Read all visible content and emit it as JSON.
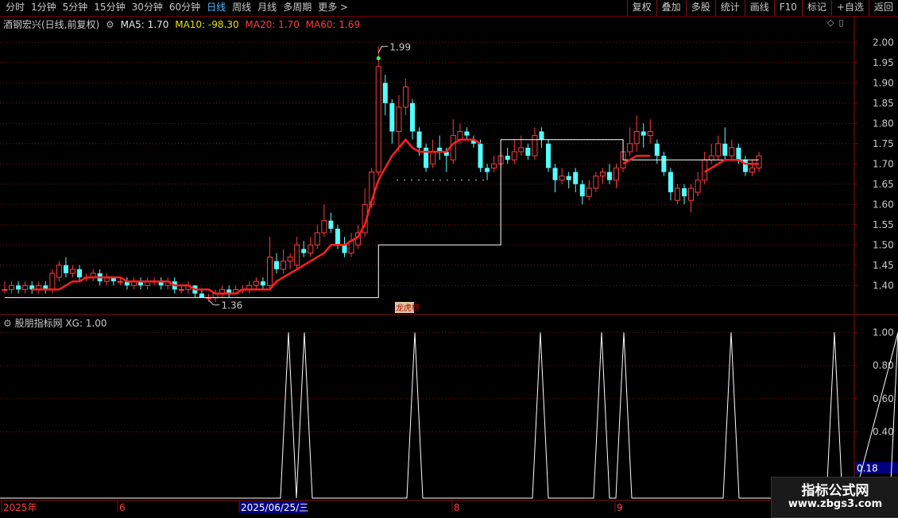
{
  "toolbar": {
    "periods": [
      "分时",
      "1分钟",
      "5分钟",
      "15分钟",
      "30分钟",
      "60分钟",
      "日线",
      "周线",
      "月线",
      "多周期",
      "更多 >"
    ],
    "active_period": "日线",
    "right_buttons": [
      "复权",
      "叠加",
      "多股",
      "统计",
      "画线",
      "F10",
      "标记",
      "+自选",
      "返回"
    ]
  },
  "main_panel": {
    "stock_label": "酒钢宏兴(日线,前复权)",
    "ma5": "MA5: 1.70",
    "ma10": "MA10: -98.30",
    "ma20": "MA20: 1.70",
    "ma60": "MA60: 1.69",
    "high_annotation": "1.99",
    "low_annotation": "1.36",
    "tag_label": "龙虎榜"
  },
  "sub_panel": {
    "title": "股朋指标网 XG: 1.00",
    "current_value": "0.18"
  },
  "x_axis": {
    "labels": [
      "2025年",
      "6",
      "2025/06/25/三",
      "8",
      "9"
    ]
  },
  "colors": {
    "up": "#ff3c3c",
    "down": "#54ffff",
    "grid": "#8a1010",
    "ma_red": "#ff2020",
    "ma_white": "#ffffff",
    "indicator": "#ffffff"
  },
  "watermark": {
    "title": "指标公式网",
    "url": "www.zbgs3.com"
  },
  "chart_data": [
    {
      "type": "candlestick",
      "ylim": [
        1.33,
        2.03
      ],
      "yticks": [
        1.4,
        1.45,
        1.5,
        1.55,
        1.6,
        1.65,
        1.7,
        1.75,
        1.8,
        1.85,
        1.9,
        1.95,
        2.0
      ],
      "candles": [
        [
          1.39,
          1.39,
          1.41,
          1.38
        ],
        [
          1.39,
          1.4,
          1.41,
          1.38
        ],
        [
          1.4,
          1.39,
          1.41,
          1.38
        ],
        [
          1.39,
          1.4,
          1.41,
          1.38
        ],
        [
          1.4,
          1.39,
          1.41,
          1.38
        ],
        [
          1.39,
          1.4,
          1.41,
          1.38
        ],
        [
          1.4,
          1.39,
          1.41,
          1.38
        ],
        [
          1.39,
          1.43,
          1.44,
          1.38
        ],
        [
          1.42,
          1.45,
          1.46,
          1.41
        ],
        [
          1.45,
          1.43,
          1.47,
          1.42
        ],
        [
          1.43,
          1.44,
          1.45,
          1.42
        ],
        [
          1.44,
          1.42,
          1.45,
          1.41
        ],
        [
          1.42,
          1.42,
          1.43,
          1.41
        ],
        [
          1.42,
          1.43,
          1.44,
          1.41
        ],
        [
          1.43,
          1.41,
          1.44,
          1.4
        ],
        [
          1.41,
          1.42,
          1.43,
          1.4
        ],
        [
          1.42,
          1.41,
          1.42,
          1.4
        ],
        [
          1.41,
          1.41,
          1.42,
          1.4
        ],
        [
          1.41,
          1.4,
          1.42,
          1.39
        ],
        [
          1.4,
          1.41,
          1.42,
          1.39
        ],
        [
          1.41,
          1.4,
          1.42,
          1.39
        ],
        [
          1.4,
          1.41,
          1.42,
          1.39
        ],
        [
          1.41,
          1.41,
          1.42,
          1.4
        ],
        [
          1.41,
          1.4,
          1.42,
          1.39
        ],
        [
          1.4,
          1.41,
          1.42,
          1.39
        ],
        [
          1.41,
          1.39,
          1.42,
          1.38
        ],
        [
          1.39,
          1.39,
          1.4,
          1.38
        ],
        [
          1.39,
          1.4,
          1.41,
          1.38
        ],
        [
          1.4,
          1.38,
          1.4,
          1.37
        ],
        [
          1.38,
          1.37,
          1.39,
          1.37
        ],
        [
          1.37,
          1.37,
          1.38,
          1.36
        ],
        [
          1.37,
          1.38,
          1.39,
          1.36
        ],
        [
          1.38,
          1.39,
          1.4,
          1.37
        ],
        [
          1.39,
          1.38,
          1.4,
          1.37
        ],
        [
          1.38,
          1.39,
          1.4,
          1.38
        ],
        [
          1.39,
          1.39,
          1.4,
          1.38
        ],
        [
          1.39,
          1.4,
          1.41,
          1.38
        ],
        [
          1.4,
          1.41,
          1.42,
          1.39
        ],
        [
          1.41,
          1.4,
          1.42,
          1.39
        ],
        [
          1.4,
          1.47,
          1.52,
          1.39
        ],
        [
          1.46,
          1.44,
          1.48,
          1.43
        ],
        [
          1.44,
          1.46,
          1.49,
          1.43
        ],
        [
          1.46,
          1.47,
          1.48,
          1.44
        ],
        [
          1.45,
          1.5,
          1.52,
          1.44
        ],
        [
          1.49,
          1.48,
          1.51,
          1.47
        ],
        [
          1.48,
          1.5,
          1.52,
          1.47
        ],
        [
          1.5,
          1.53,
          1.55,
          1.49
        ],
        [
          1.53,
          1.56,
          1.6,
          1.52
        ],
        [
          1.56,
          1.54,
          1.58,
          1.53
        ],
        [
          1.54,
          1.5,
          1.55,
          1.49
        ],
        [
          1.5,
          1.48,
          1.52,
          1.47
        ],
        [
          1.48,
          1.51,
          1.53,
          1.47
        ],
        [
          1.5,
          1.53,
          1.55,
          1.49
        ],
        [
          1.53,
          1.6,
          1.64,
          1.52
        ],
        [
          1.6,
          1.68,
          1.69,
          1.59
        ],
        [
          1.68,
          1.94,
          1.99,
          1.67
        ],
        [
          1.9,
          1.85,
          1.92,
          1.82
        ],
        [
          1.85,
          1.78,
          1.86,
          1.75
        ],
        [
          1.78,
          1.84,
          1.87,
          1.73
        ],
        [
          1.84,
          1.89,
          1.91,
          1.82
        ],
        [
          1.85,
          1.78,
          1.86,
          1.76
        ],
        [
          1.78,
          1.74,
          1.79,
          1.72
        ],
        [
          1.74,
          1.69,
          1.75,
          1.68
        ],
        [
          1.7,
          1.73,
          1.76,
          1.69
        ],
        [
          1.74,
          1.73,
          1.77,
          1.71
        ],
        [
          1.73,
          1.72,
          1.74,
          1.68
        ],
        [
          1.71,
          1.77,
          1.81,
          1.7
        ],
        [
          1.76,
          1.78,
          1.8,
          1.75
        ],
        [
          1.78,
          1.77,
          1.79,
          1.76
        ],
        [
          1.76,
          1.75,
          1.77,
          1.74
        ],
        [
          1.75,
          1.69,
          1.76,
          1.68
        ],
        [
          1.69,
          1.68,
          1.7,
          1.66
        ],
        [
          1.69,
          1.7,
          1.72,
          1.68
        ],
        [
          1.7,
          1.72,
          1.73,
          1.69
        ],
        [
          1.72,
          1.71,
          1.74,
          1.7
        ],
        [
          1.71,
          1.73,
          1.76,
          1.7
        ],
        [
          1.73,
          1.74,
          1.77,
          1.72
        ],
        [
          1.74,
          1.72,
          1.75,
          1.71
        ],
        [
          1.72,
          1.77,
          1.79,
          1.71
        ],
        [
          1.78,
          1.76,
          1.79,
          1.74
        ],
        [
          1.75,
          1.69,
          1.76,
          1.68
        ],
        [
          1.69,
          1.66,
          1.7,
          1.63
        ],
        [
          1.66,
          1.67,
          1.69,
          1.65
        ],
        [
          1.67,
          1.66,
          1.68,
          1.64
        ],
        [
          1.68,
          1.65,
          1.69,
          1.63
        ],
        [
          1.65,
          1.62,
          1.66,
          1.6
        ],
        [
          1.62,
          1.64,
          1.66,
          1.61
        ],
        [
          1.64,
          1.67,
          1.68,
          1.63
        ],
        [
          1.67,
          1.68,
          1.69,
          1.65
        ],
        [
          1.68,
          1.66,
          1.7,
          1.65
        ],
        [
          1.66,
          1.69,
          1.7,
          1.64
        ],
        [
          1.69,
          1.73,
          1.76,
          1.68
        ],
        [
          1.73,
          1.75,
          1.79,
          1.72
        ],
        [
          1.75,
          1.78,
          1.82,
          1.73
        ],
        [
          1.78,
          1.77,
          1.8,
          1.74
        ],
        [
          1.77,
          1.78,
          1.81,
          1.75
        ],
        [
          1.75,
          1.72,
          1.76,
          1.7
        ],
        [
          1.72,
          1.68,
          1.73,
          1.67
        ],
        [
          1.68,
          1.63,
          1.69,
          1.61
        ],
        [
          1.61,
          1.64,
          1.65,
          1.6
        ],
        [
          1.64,
          1.62,
          1.65,
          1.6
        ],
        [
          1.61,
          1.64,
          1.65,
          1.58
        ],
        [
          1.63,
          1.66,
          1.68,
          1.62
        ],
        [
          1.66,
          1.71,
          1.73,
          1.65
        ],
        [
          1.71,
          1.72,
          1.75,
          1.7
        ],
        [
          1.72,
          1.75,
          1.77,
          1.71
        ],
        [
          1.75,
          1.72,
          1.79,
          1.71
        ],
        [
          1.72,
          1.74,
          1.76,
          1.71
        ],
        [
          1.74,
          1.71,
          1.75,
          1.7
        ],
        [
          1.71,
          1.68,
          1.72,
          1.67
        ],
        [
          1.68,
          1.69,
          1.71,
          1.67
        ],
        [
          1.69,
          1.72,
          1.73,
          1.68
        ]
      ],
      "ma_red": [
        null,
        null,
        null,
        null,
        1.39,
        1.39,
        1.39,
        1.39,
        1.39,
        1.4,
        1.41,
        1.41,
        1.42,
        1.42,
        1.42,
        1.42,
        1.42,
        1.42,
        1.41,
        1.41,
        1.41,
        1.41,
        1.41,
        1.41,
        1.41,
        1.4,
        1.4,
        1.4,
        1.39,
        1.39,
        1.39,
        1.38,
        1.38,
        1.38,
        1.38,
        1.39,
        1.39,
        1.39,
        1.39,
        1.39,
        1.41,
        1.42,
        1.43,
        1.44,
        1.45,
        1.46,
        1.47,
        1.48,
        1.5,
        1.5,
        1.5,
        1.51,
        1.52,
        1.55,
        1.61,
        1.66,
        1.69,
        1.72,
        1.74,
        1.76,
        1.74,
        1.73,
        1.73,
        1.73,
        1.73,
        1.73,
        1.75,
        1.76,
        1.76,
        1.76,
        1.75,
        null,
        null,
        null,
        null,
        null,
        null,
        null,
        null,
        null,
        null,
        null,
        null,
        null,
        null,
        null,
        null,
        null,
        null,
        null,
        null,
        1.7,
        1.71,
        1.72,
        1.72,
        1.72,
        null,
        null,
        null,
        null,
        null,
        null,
        null,
        1.68,
        1.69,
        1.7,
        1.71,
        1.71,
        1.71,
        1.7,
        1.7,
        1.7
      ],
      "ma_white_steps": [
        {
          "from": 0,
          "to": 37,
          "value": 1.37
        },
        {
          "from": 37,
          "to": 55,
          "value": 1.37
        },
        {
          "from": 55,
          "to": 73,
          "value": 1.5
        },
        {
          "from": 73,
          "to": 91,
          "value": 1.76
        },
        {
          "from": 91,
          "to": 119,
          "value": 1.71
        }
      ]
    },
    {
      "type": "line",
      "ylim": [
        0,
        1.05
      ],
      "yticks": [
        0.4,
        0.6,
        0.8,
        1.0
      ],
      "spike_centers": [
        363,
        383,
        522,
        680,
        757,
        785,
        920,
        1050,
        1130
      ]
    }
  ]
}
